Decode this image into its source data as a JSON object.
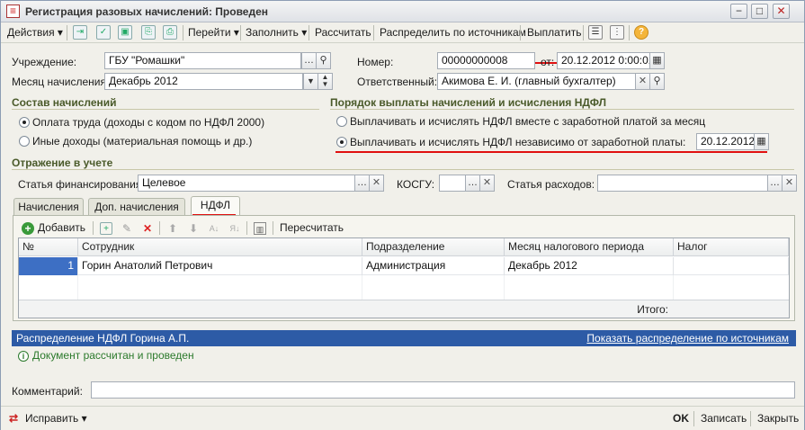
{
  "window": {
    "title": "Регистрация разовых начислений: Проведен",
    "title_icon": "document-icon",
    "controls": [
      "minimize-icon",
      "maximize-icon",
      "close-icon"
    ]
  },
  "toolbar": {
    "actions": "Действия",
    "goto": "Перейти",
    "fill": "Заполнить",
    "calc": "Рассчитать",
    "distribute": "Распределить по источникам",
    "pay": "Выплатить"
  },
  "form": {
    "org_label": "Учреждение:",
    "org_value": "ГБУ \"Ромашки\"",
    "month_label": "Месяц начисления:",
    "month_value": "Декабрь 2012",
    "number_label": "Номер:",
    "number_value": "00000000008",
    "from_label": "от:",
    "date_value": "20.12.2012  0:00:01",
    "resp_label": "Ответственный:",
    "resp_value": "Акимова Е. И. (главный бухгалтер)"
  },
  "composition": {
    "title": "Состав начислений",
    "options": [
      {
        "label": "Оплата труда (доходы с кодом по НДФЛ 2000)",
        "selected": true
      },
      {
        "label": "Иные доходы (материальная помощь и др.)",
        "selected": false
      }
    ]
  },
  "payment_order": {
    "title": "Порядок выплаты начислений и исчисления НДФЛ",
    "options": [
      {
        "label": "Выплачивать и исчислять НДФЛ вместе с заработной платой за месяц",
        "selected": false
      },
      {
        "label": "Выплачивать и исчислять НДФЛ независимо от заработной платы:",
        "selected": true
      }
    ],
    "date_value": "20.12.2012"
  },
  "accounting": {
    "title": "Отражение в учете",
    "fin_label": "Статья финансирования:",
    "fin_value": "Целевое",
    "kosgu_label": "КОСГУ:",
    "kosgu_value": "",
    "exp_label": "Статья расходов:",
    "exp_value": ""
  },
  "tabs": [
    {
      "label": "Начисления",
      "active": false
    },
    {
      "label": "Доп. начисления",
      "active": false
    },
    {
      "label": "НДФЛ",
      "active": true
    }
  ],
  "table_toolbar": {
    "add": "Добавить",
    "recalc": "Пересчитать"
  },
  "table": {
    "columns": [
      "№",
      "Сотрудник",
      "Подразделение",
      "Месяц налогового периода",
      "Налог"
    ],
    "rows": [
      {
        "num": "1",
        "employee": "Горин Анатолий Петрович",
        "department": "Администрация",
        "month": "Декабрь 2012",
        "tax": ""
      }
    ],
    "total_label": "Итого:"
  },
  "distribution": {
    "title": "Распределение НДФЛ Горина А.П.",
    "link": "Показать распределение по источникам"
  },
  "status_text": "Документ рассчитан и проведен",
  "comment_label": "Комментарий:",
  "comment_value": "",
  "footer": {
    "edit": "Исправить",
    "ok": "OK",
    "save": "Записать",
    "close": "Закрыть"
  },
  "colors": {
    "highlight_red": "#e01010",
    "section_title": "#4a5a2a",
    "info_bar": "#2d5ba6",
    "status_green": "#2c7a2c"
  }
}
